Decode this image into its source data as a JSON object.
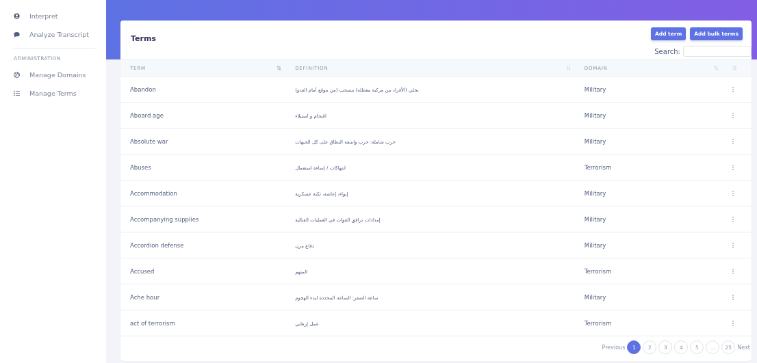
{
  "sidebar": {
    "items": [
      {
        "label": "Interpret",
        "kind": "user",
        "selected": false
      },
      {
        "label": "Analyze Transcript",
        "kind": "chat",
        "selected": false
      }
    ],
    "section_title": "ADMINISTRATION",
    "admin_items": [
      {
        "label": "Manage Domains",
        "kind": "globe",
        "selected": false
      },
      {
        "label": "Manage Terms",
        "kind": "list",
        "selected": false
      }
    ]
  },
  "card": {
    "title": "Terms",
    "buttons": [
      "Add term",
      "Add bulk terms"
    ],
    "search": {
      "label": "Search:"
    }
  },
  "table": {
    "columns": [
      {
        "label": "TERM",
        "sorted": true
      },
      {
        "label": "DEFINITION",
        "sorted": false
      },
      {
        "label": "DOMAIN",
        "sorted": false
      },
      {
        "sorted": false
      }
    ],
    "rows": [
      {
        "term": "Abandon",
        "definition": "يخلي (الأفراد من مركبة معطلة) ينسحب (من موقع أمام العدو)",
        "domain": "Military"
      },
      {
        "term": "Aboard age",
        "definition": "اقتحام و استيلاء",
        "domain": "Military"
      },
      {
        "term": "Absolute war",
        "definition": "حرب شاملة: حرب واسعة النطاق على كل الجبهات",
        "domain": "Military"
      },
      {
        "term": "Abuses",
        "definition": "انتهاكات / إساءة استعمال",
        "domain": "Terrorism"
      },
      {
        "term": "Accommodation",
        "definition": "إيواء، إعاشة، ثكنة عسكرية",
        "domain": "Military"
      },
      {
        "term": "Accompanying supplies",
        "definition": "إمدادات ترافق القوات في العمليات القتالية",
        "domain": "Military"
      },
      {
        "term": "Accordion defense",
        "definition": "دفاع مرن",
        "domain": "Military"
      },
      {
        "term": "Accused",
        "definition": "المتهم",
        "domain": "Terrorism"
      },
      {
        "term": "Ache hour",
        "definition": "ساعة الصفر: الساعة المحددة لبدء الهجوم",
        "domain": "Military"
      },
      {
        "term": "act of terrorism",
        "definition": "عمل إرهابي",
        "domain": "Terrorism"
      }
    ]
  },
  "pagination": {
    "previous": "Previous",
    "next": "Next",
    "pages": [
      {
        "label": "1",
        "selected": true
      },
      {
        "label": "2",
        "selected": false
      },
      {
        "label": "3",
        "selected": false
      },
      {
        "label": "4",
        "selected": false
      },
      {
        "label": "5",
        "selected": false
      },
      {
        "label": "…",
        "selected": false
      },
      {
        "label": "25",
        "selected": false
      }
    ]
  }
}
